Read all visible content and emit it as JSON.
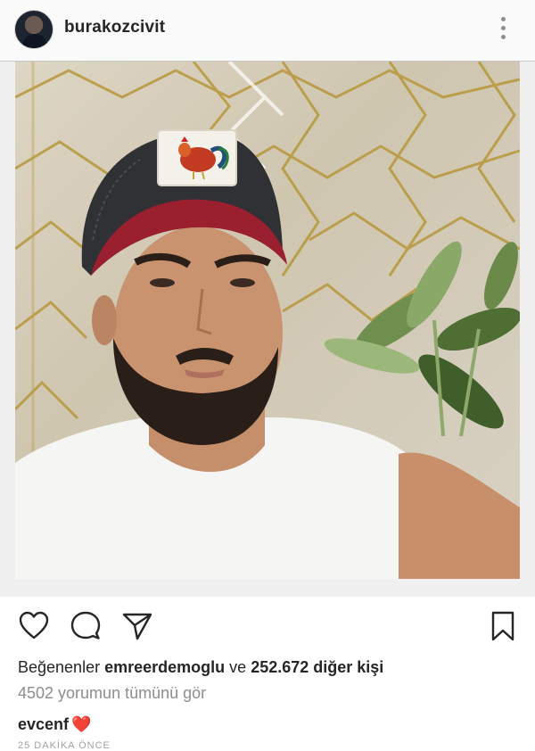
{
  "post": {
    "username": "burakozcivit",
    "more_icon": "more-vertical-icon"
  },
  "photo": {
    "description_icon": "post-photo"
  },
  "actions": {
    "like_icon": "heart-icon",
    "comment_icon": "comment-icon",
    "share_icon": "send-icon",
    "save_icon": "bookmark-icon"
  },
  "likes": {
    "prefix": "Beğenenler",
    "user": "emreerdemoglu",
    "connector": "ve",
    "count_text": "252.672 diğer kişi"
  },
  "comments": {
    "view_all": "4502 yorumun tümünü gör",
    "first_user": "evcenf",
    "first_text": "❤️"
  },
  "timestamp": "25 DAKİKA ÖNCE",
  "colors": {
    "text": "#262626",
    "muted": "#8e8e8e",
    "heart": "#e0245e"
  }
}
